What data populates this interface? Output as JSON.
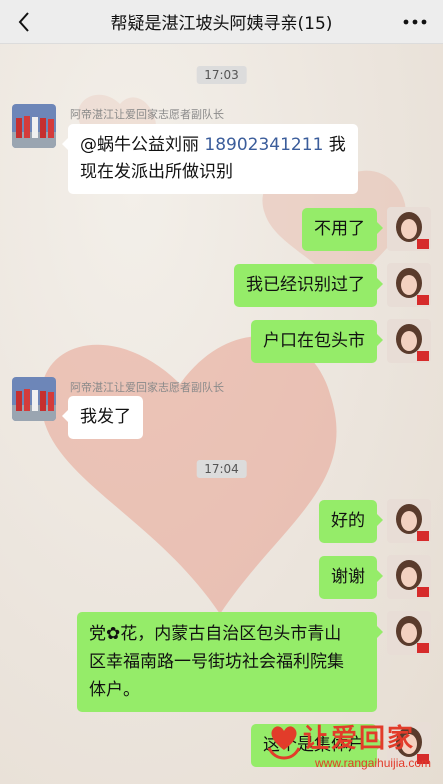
{
  "header": {
    "title": "帮疑是湛江坡头阿姨寻亲(15)"
  },
  "timestamps": [
    "17:03",
    "17:04"
  ],
  "messages": [
    {
      "sender": "阿帝湛江让爱回家志愿者副队长",
      "parts": [
        "@蜗牛公益刘丽 ",
        "18902341211",
        " 我",
        "现在发派出所做识别"
      ]
    },
    {
      "text": "不用了"
    },
    {
      "text": "我已经识别过了"
    },
    {
      "text": "户口在包头市"
    },
    {
      "sender": "阿帝湛江让爱回家志愿者副队长",
      "text": "我发了"
    },
    {
      "text": "好的"
    },
    {
      "text": "谢谢"
    },
    {
      "lines": [
        "党✿花，内蒙古自治区包头市青山",
        "区幸福南路一号街坊社会福利院集",
        "体户。"
      ]
    },
    {
      "text": "这个是集体户"
    }
  ],
  "watermark": {
    "title": "让爱回家",
    "url": "www.rangaihuijia.com"
  },
  "colors": {
    "self_bubble": "#95ec69",
    "other_bubble": "#ffffff",
    "watermark": "#e23c2a"
  }
}
